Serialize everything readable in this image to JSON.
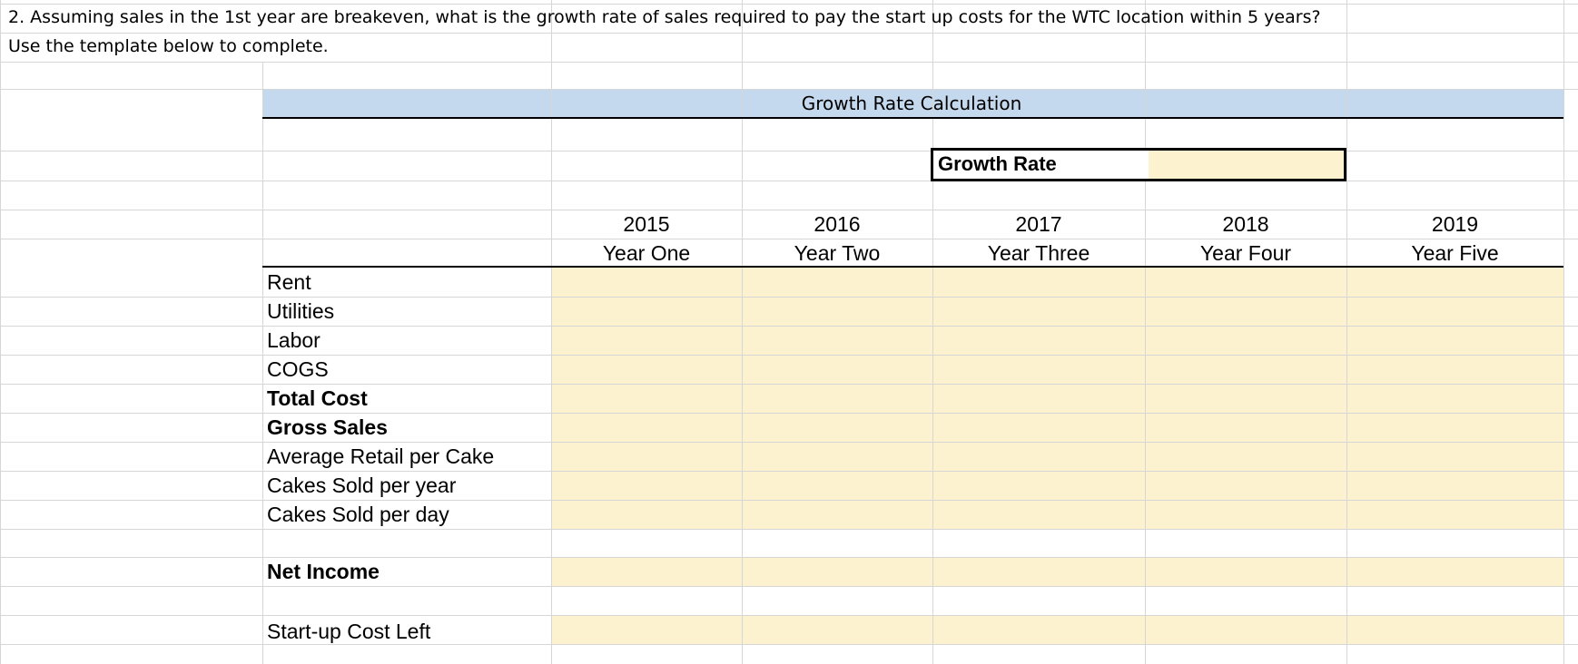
{
  "question": "2.  Assuming sales in the 1st year are breakeven, what is the growth rate of sales required to pay the start up costs for the WTC location within 5 years?",
  "instruction": "Use the template below to complete.",
  "table_title": "Growth Rate Calculation",
  "growth_rate_label": "Growth Rate",
  "growth_rate_value": "",
  "columns": [
    {
      "year": "2015",
      "label": "Year One"
    },
    {
      "year": "2016",
      "label": "Year Two"
    },
    {
      "year": "2017",
      "label": "Year Three"
    },
    {
      "year": "2018",
      "label": "Year Four"
    },
    {
      "year": "2019",
      "label": "Year Five"
    }
  ],
  "rows": [
    {
      "label": "Rent"
    },
    {
      "label": "Utilities"
    },
    {
      "label": "Labor"
    },
    {
      "label": "COGS"
    },
    {
      "label": "Total Cost"
    },
    {
      "label": "Gross Sales"
    },
    {
      "label": "Average Retail per Cake"
    },
    {
      "label": "Cakes Sold per year"
    },
    {
      "label": "Cakes Sold per day"
    }
  ],
  "net_income_label": "Net Income",
  "startup_cost_label": "Start-up Cost Left",
  "colors": {
    "header_band": "#c5d9ee",
    "input_fill": "#fdf2d0",
    "gridline": "#d6d6d6"
  }
}
